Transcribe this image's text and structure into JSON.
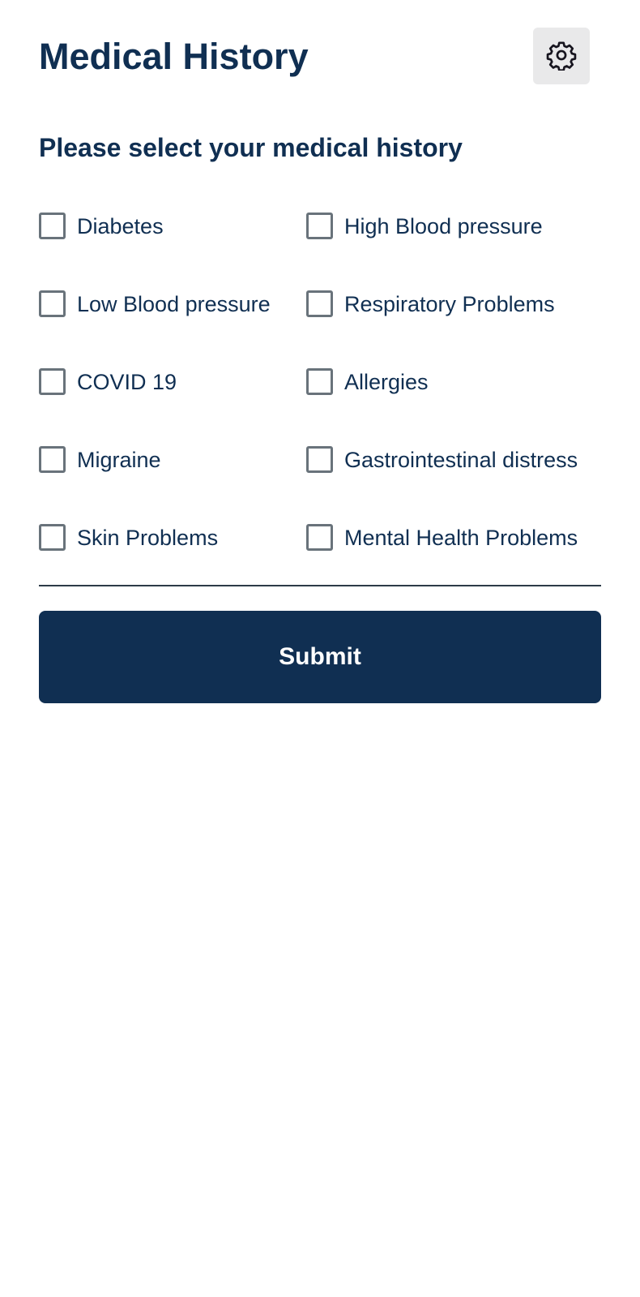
{
  "header": {
    "title": "Medical History",
    "settings_icon": "gear-icon"
  },
  "form": {
    "prompt": "Please select your medical history",
    "options": [
      {
        "label": "Diabetes",
        "checked": false
      },
      {
        "label": "High Blood pressure",
        "checked": false
      },
      {
        "label": "Low Blood pressure",
        "checked": false
      },
      {
        "label": "Respiratory Problems",
        "checked": false
      },
      {
        "label": "COVID 19",
        "checked": false
      },
      {
        "label": "Allergies",
        "checked": false
      },
      {
        "label": "Migraine",
        "checked": false
      },
      {
        "label": "Gastrointestinal distress",
        "checked": false
      },
      {
        "label": "Skin Problems",
        "checked": false
      },
      {
        "label": "Mental Health Problems",
        "checked": false
      }
    ],
    "submit_label": "Submit"
  },
  "colors": {
    "brand_navy": "#102f52",
    "checkbox_border": "#69737b",
    "settings_background": "#e9e9ea"
  }
}
